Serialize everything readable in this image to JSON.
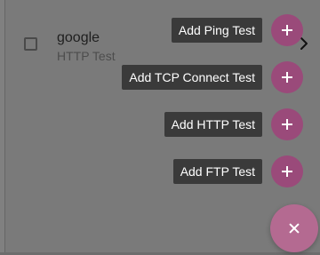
{
  "list": {
    "items": [
      {
        "title": "google",
        "subtitle": "HTTP Test"
      }
    ]
  },
  "fab_menu": {
    "actions": [
      {
        "label": "Add Ping Test",
        "icon": "plus-icon"
      },
      {
        "label": "Add TCP Connect Test",
        "icon": "plus-icon"
      },
      {
        "label": "Add HTTP Test",
        "icon": "plus-icon"
      },
      {
        "label": "Add FTP Test",
        "icon": "plus-icon"
      }
    ],
    "close_icon": "close-icon"
  },
  "colors": {
    "overlay": "#7a7a7a",
    "fab_mini": "#9a4a7a",
    "fab_main": "#b46a91",
    "label_bg": "#3a3a3a",
    "label_text": "#ffffff"
  }
}
